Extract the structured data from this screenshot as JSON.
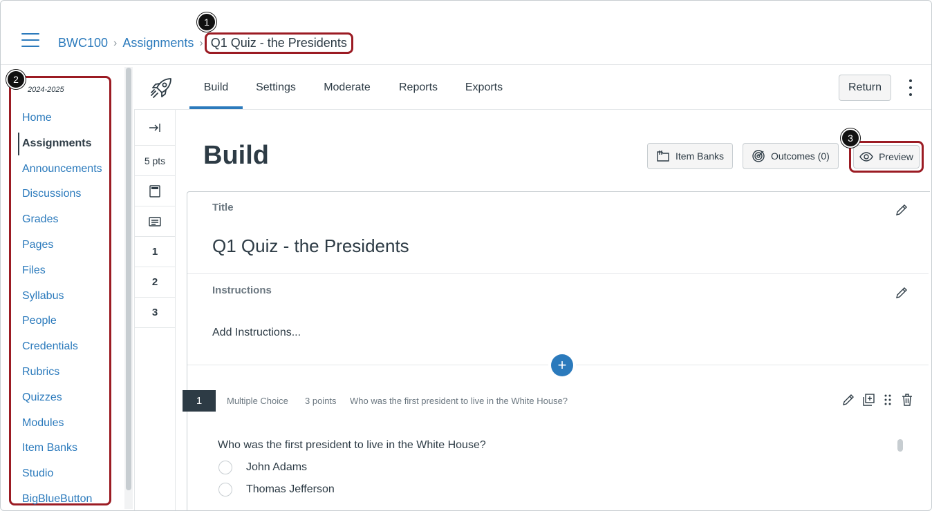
{
  "header": {
    "breadcrumb": [
      "BWC100",
      "Assignments"
    ],
    "current": "Q1 Quiz - the Presidents"
  },
  "badges": [
    "1",
    "2",
    "3"
  ],
  "course_nav": {
    "term": "2024-2025",
    "items": [
      "Home",
      "Assignments",
      "Announcements",
      "Discussions",
      "Grades",
      "Pages",
      "Files",
      "Syllabus",
      "People",
      "Credentials",
      "Rubrics",
      "Quizzes",
      "Modules",
      "Item Banks",
      "Studio",
      "BigBlueButton"
    ],
    "active": "Assignments"
  },
  "tabs": [
    "Build",
    "Settings",
    "Moderate",
    "Reports",
    "Exports"
  ],
  "active_tab": "Build",
  "return_label": "Return",
  "rail": {
    "points": "5 pts",
    "questions": [
      "1",
      "2",
      "3"
    ]
  },
  "build": {
    "heading": "Build",
    "item_banks_label": "Item Banks",
    "outcomes_label": "Outcomes (0)",
    "preview_label": "Preview",
    "title_label": "Title",
    "quiz_title": "Q1 Quiz - the Presidents",
    "instructions_label": "Instructions",
    "add_instructions": "Add Instructions..."
  },
  "question": {
    "number": "1",
    "type": "Multiple Choice",
    "points": "3 points",
    "summary": "Who was the first president to live in the White House?",
    "text": "Who was the first president to live in the White House?",
    "answers": [
      "John Adams",
      "Thomas Jefferson"
    ]
  },
  "colors": {
    "link": "#2b7abc",
    "highlight": "#9b1b23",
    "text": "#2d3b45"
  }
}
